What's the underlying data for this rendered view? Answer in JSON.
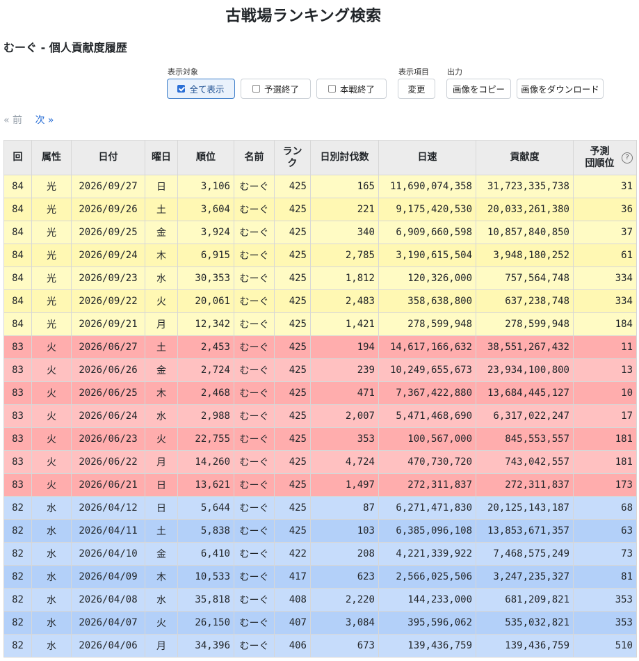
{
  "page_title": "古戦場ランキング検索",
  "sub_title": "むーぐ - 個人貢献度履歴",
  "filters": {
    "display_target_label": "表示対象",
    "buttons": [
      {
        "label": "全て表示",
        "checked": true
      },
      {
        "label": "予選終了",
        "checked": false
      },
      {
        "label": "本戦終了",
        "checked": false
      }
    ],
    "display_item_label": "表示項目",
    "change_label": "変更",
    "output_label": "出力",
    "copy_image_label": "画像をコピー",
    "download_image_label": "画像をダウンロード"
  },
  "pager": {
    "prev": "« 前",
    "next": "次 »"
  },
  "columns": [
    "回",
    "属性",
    "日付",
    "曜日",
    "順位",
    "名前",
    "ランク",
    "日別討伐数",
    "日速",
    "貢献度",
    "予測\n団順位"
  ],
  "help_icon": "?",
  "colors": {
    "light_yellow": "#fffbc4",
    "light_yellow_alt": "#fff8b3",
    "fire": "#ffc1c1",
    "fire_alt": "#ffadad",
    "water": "#c6dcfb",
    "water_alt": "#b3d0f9"
  },
  "rows": [
    {
      "round": "84",
      "attr": "光",
      "date": "2026/09/27",
      "day": "日",
      "rank": "3,106",
      "name": "むーぐ",
      "level": "425",
      "daily": "165",
      "speed": "11,690,074,358",
      "contrib": "31,723,335,738",
      "pred": "31"
    },
    {
      "round": "84",
      "attr": "光",
      "date": "2026/09/26",
      "day": "土",
      "rank": "3,604",
      "name": "むーぐ",
      "level": "425",
      "daily": "221",
      "speed": "9,175,420,530",
      "contrib": "20,033,261,380",
      "pred": "36"
    },
    {
      "round": "84",
      "attr": "光",
      "date": "2026/09/25",
      "day": "金",
      "rank": "3,924",
      "name": "むーぐ",
      "level": "425",
      "daily": "340",
      "speed": "6,909,660,598",
      "contrib": "10,857,840,850",
      "pred": "37"
    },
    {
      "round": "84",
      "attr": "光",
      "date": "2026/09/24",
      "day": "木",
      "rank": "6,915",
      "name": "むーぐ",
      "level": "425",
      "daily": "2,785",
      "speed": "3,190,615,504",
      "contrib": "3,948,180,252",
      "pred": "61"
    },
    {
      "round": "84",
      "attr": "光",
      "date": "2026/09/23",
      "day": "水",
      "rank": "30,353",
      "name": "むーぐ",
      "level": "425",
      "daily": "1,812",
      "speed": "120,326,000",
      "contrib": "757,564,748",
      "pred": "334"
    },
    {
      "round": "84",
      "attr": "光",
      "date": "2026/09/22",
      "day": "火",
      "rank": "20,061",
      "name": "むーぐ",
      "level": "425",
      "daily": "2,483",
      "speed": "358,638,800",
      "contrib": "637,238,748",
      "pred": "334"
    },
    {
      "round": "84",
      "attr": "光",
      "date": "2026/09/21",
      "day": "月",
      "rank": "12,342",
      "name": "むーぐ",
      "level": "425",
      "daily": "1,421",
      "speed": "278,599,948",
      "contrib": "278,599,948",
      "pred": "184"
    },
    {
      "round": "83",
      "attr": "火",
      "date": "2026/06/27",
      "day": "土",
      "rank": "2,453",
      "name": "むーぐ",
      "level": "425",
      "daily": "194",
      "speed": "14,617,166,632",
      "contrib": "38,551,267,432",
      "pred": "11"
    },
    {
      "round": "83",
      "attr": "火",
      "date": "2026/06/26",
      "day": "金",
      "rank": "2,724",
      "name": "むーぐ",
      "level": "425",
      "daily": "239",
      "speed": "10,249,655,673",
      "contrib": "23,934,100,800",
      "pred": "13"
    },
    {
      "round": "83",
      "attr": "火",
      "date": "2026/06/25",
      "day": "木",
      "rank": "2,468",
      "name": "むーぐ",
      "level": "425",
      "daily": "471",
      "speed": "7,367,422,880",
      "contrib": "13,684,445,127",
      "pred": "10"
    },
    {
      "round": "83",
      "attr": "火",
      "date": "2026/06/24",
      "day": "水",
      "rank": "2,988",
      "name": "むーぐ",
      "level": "425",
      "daily": "2,007",
      "speed": "5,471,468,690",
      "contrib": "6,317,022,247",
      "pred": "17"
    },
    {
      "round": "83",
      "attr": "火",
      "date": "2026/06/23",
      "day": "火",
      "rank": "22,755",
      "name": "むーぐ",
      "level": "425",
      "daily": "353",
      "speed": "100,567,000",
      "contrib": "845,553,557",
      "pred": "181"
    },
    {
      "round": "83",
      "attr": "火",
      "date": "2026/06/22",
      "day": "月",
      "rank": "14,260",
      "name": "むーぐ",
      "level": "425",
      "daily": "4,724",
      "speed": "470,730,720",
      "contrib": "743,042,557",
      "pred": "181"
    },
    {
      "round": "83",
      "attr": "火",
      "date": "2026/06/21",
      "day": "日",
      "rank": "13,621",
      "name": "むーぐ",
      "level": "425",
      "daily": "1,497",
      "speed": "272,311,837",
      "contrib": "272,311,837",
      "pred": "173"
    },
    {
      "round": "82",
      "attr": "水",
      "date": "2026/04/12",
      "day": "日",
      "rank": "5,644",
      "name": "むーぐ",
      "level": "425",
      "daily": "87",
      "speed": "6,271,471,830",
      "contrib": "20,125,143,187",
      "pred": "68"
    },
    {
      "round": "82",
      "attr": "水",
      "date": "2026/04/11",
      "day": "土",
      "rank": "5,838",
      "name": "むーぐ",
      "level": "425",
      "daily": "103",
      "speed": "6,385,096,108",
      "contrib": "13,853,671,357",
      "pred": "63"
    },
    {
      "round": "82",
      "attr": "水",
      "date": "2026/04/10",
      "day": "金",
      "rank": "6,410",
      "name": "むーぐ",
      "level": "422",
      "daily": "208",
      "speed": "4,221,339,922",
      "contrib": "7,468,575,249",
      "pred": "73"
    },
    {
      "round": "82",
      "attr": "水",
      "date": "2026/04/09",
      "day": "木",
      "rank": "10,533",
      "name": "むーぐ",
      "level": "417",
      "daily": "623",
      "speed": "2,566,025,506",
      "contrib": "3,247,235,327",
      "pred": "81"
    },
    {
      "round": "82",
      "attr": "水",
      "date": "2026/04/08",
      "day": "水",
      "rank": "35,818",
      "name": "むーぐ",
      "level": "408",
      "daily": "2,220",
      "speed": "144,233,000",
      "contrib": "681,209,821",
      "pred": "353"
    },
    {
      "round": "82",
      "attr": "水",
      "date": "2026/04/07",
      "day": "火",
      "rank": "26,150",
      "name": "むーぐ",
      "level": "407",
      "daily": "3,084",
      "speed": "395,596,062",
      "contrib": "535,032,821",
      "pred": "353"
    },
    {
      "round": "82",
      "attr": "水",
      "date": "2026/04/06",
      "day": "月",
      "rank": "34,396",
      "name": "むーぐ",
      "level": "406",
      "daily": "673",
      "speed": "139,436,759",
      "contrib": "139,436,759",
      "pred": "510"
    }
  ]
}
